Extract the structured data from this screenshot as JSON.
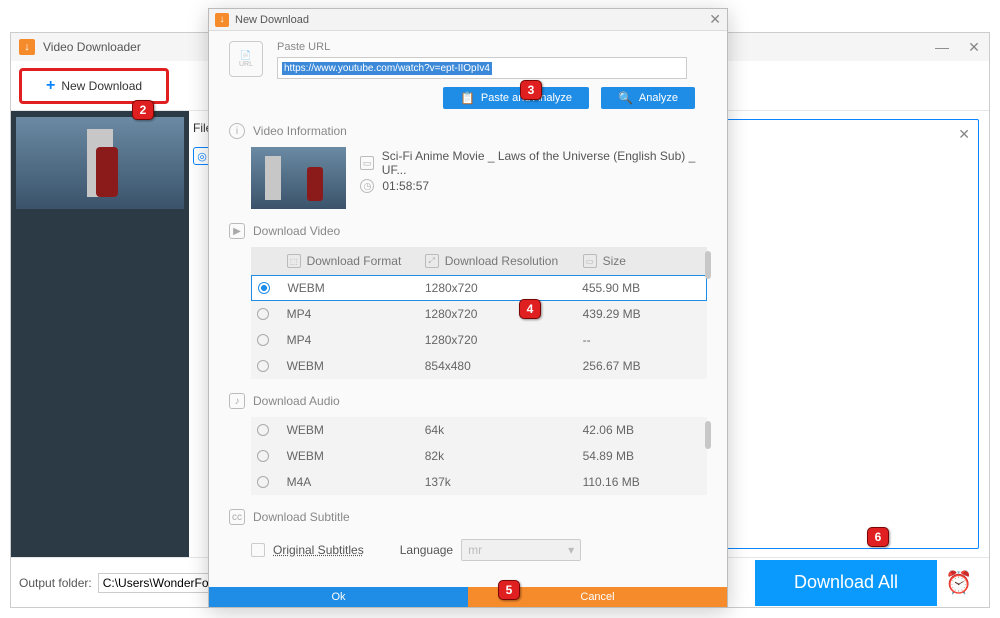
{
  "main": {
    "title": "Video Downloader",
    "new_download": "New Download",
    "file_menu": "File",
    "output_label": "Output folder:",
    "output_path": "C:\\Users\\WonderFox\\",
    "download_all": "Download All"
  },
  "dialog": {
    "title": "New Download",
    "paste_url_label": "Paste URL",
    "url_value": "https://www.youtube.com/watch?v=ept-IIOpIv4",
    "paste_analyze": "Paste and Analyze",
    "analyze": "Analyze",
    "video_info_label": "Video Information",
    "video_title": "Sci-Fi Anime Movie _ Laws of the Universe (English Sub) _ UF...",
    "video_duration": "01:58:57",
    "download_video_label": "Download Video",
    "format_header": "Download Format",
    "resolution_header": "Download Resolution",
    "size_header": "Size",
    "video_rows": [
      {
        "format": "WEBM",
        "resolution": "1280x720",
        "size": "455.90 MB",
        "selected": true
      },
      {
        "format": "MP4",
        "resolution": "1280x720",
        "size": "439.29 MB",
        "selected": false
      },
      {
        "format": "MP4",
        "resolution": "1280x720",
        "size": "--",
        "selected": false
      },
      {
        "format": "WEBM",
        "resolution": "854x480",
        "size": "256.67 MB",
        "selected": false
      }
    ],
    "download_audio_label": "Download Audio",
    "audio_rows": [
      {
        "format": "WEBM",
        "resolution": "64k",
        "size": "42.06 MB",
        "selected": false
      },
      {
        "format": "WEBM",
        "resolution": "82k",
        "size": "54.89 MB",
        "selected": false
      },
      {
        "format": "M4A",
        "resolution": "137k",
        "size": "110.16 MB",
        "selected": false
      }
    ],
    "download_subtitle_label": "Download Subtitle",
    "original_subtitles": "Original Subtitles",
    "language_label": "Language",
    "language_value": "mr",
    "ok": "Ok",
    "cancel": "Cancel"
  },
  "callouts": {
    "c2": "2",
    "c3": "3",
    "c4": "4",
    "c5": "5",
    "c6": "6"
  }
}
